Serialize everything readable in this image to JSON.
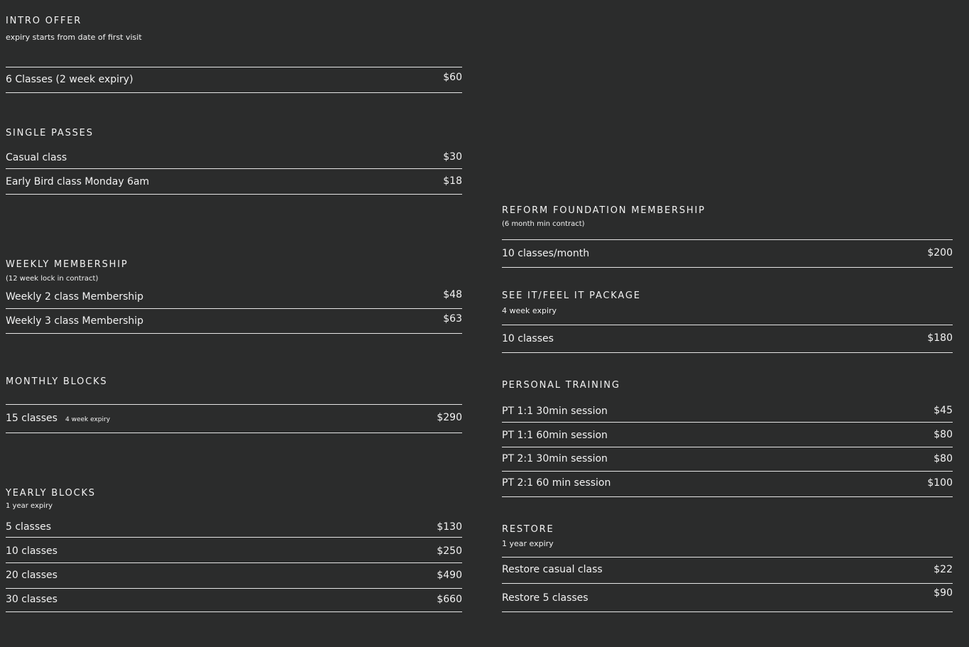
{
  "intro_offer": {
    "title": "INTRO OFFER",
    "subtitle": "expiry starts from date of first visit",
    "items": [
      {
        "label": "6 Classes (2 week expiry)",
        "price": "$60"
      }
    ]
  },
  "single_passes": {
    "title": "SINGLE PASSES",
    "items": [
      {
        "label": "Casual class",
        "price": "$30"
      },
      {
        "label": "Early Bird class Monday 6am",
        "price": "$18"
      }
    ]
  },
  "weekly_membership": {
    "title": "WEEKLY MEMBERSHIP",
    "subtitle": "(12 week lock in contract)",
    "items": [
      {
        "label": "Weekly 2 class Membership",
        "price": "$48"
      },
      {
        "label": "Weekly 3 class Membership",
        "price": "$63"
      }
    ]
  },
  "monthly_blocks": {
    "title": "MONTHLY BLOCKS",
    "items": [
      {
        "label": "15 classes",
        "note": "4 week  expiry",
        "price": "$290"
      }
    ]
  },
  "yearly_blocks": {
    "title": "YEARLY BLOCKS",
    "subtitle": "1 year expiry",
    "items": [
      {
        "label": "5 classes",
        "price": "$130"
      },
      {
        "label": "10 classes",
        "price": "$250"
      },
      {
        "label": "20 classes",
        "price": "$490"
      },
      {
        "label": "30 classes",
        "price": "$660"
      }
    ]
  },
  "reform_foundation": {
    "title": "REFORM FOUNDATION MEMBERSHIP",
    "subtitle": "(6 month min contract)",
    "items": [
      {
        "label": "10 classes/month",
        "price": "$200"
      }
    ]
  },
  "see_it_feel_it": {
    "title": "SEE IT/FEEL IT PACKAGE",
    "subtitle": "4 week expiry",
    "items": [
      {
        "label": "10 classes",
        "price": "$180"
      }
    ]
  },
  "personal_training": {
    "title": "PERSONAL TRAINING",
    "items": [
      {
        "label": "PT 1:1 30min session",
        "price": "$45"
      },
      {
        "label": "PT 1:1 60min session",
        "price": "$80"
      },
      {
        "label": "PT 2:1 30min session",
        "price": "$80"
      },
      {
        "label": "PT 2:1 60 min session",
        "price": "$100"
      }
    ]
  },
  "restore": {
    "title": "RESTORE",
    "subtitle": "1 year expiry",
    "items": [
      {
        "label": "Restore casual class",
        "price": "$22"
      },
      {
        "label": "Restore 5 classes",
        "price": "$90"
      }
    ]
  },
  "colors": {
    "background": "#2b2c2c",
    "text": "#f2f2f2",
    "rule": "#e6e6e6"
  }
}
